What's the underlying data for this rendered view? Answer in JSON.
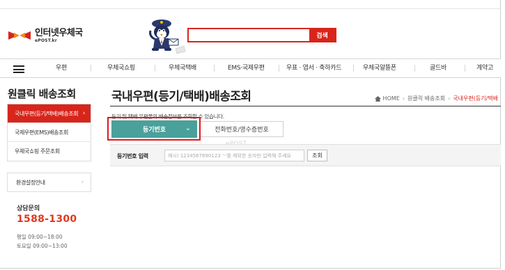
{
  "header": {
    "logo_ko": "인터넷우체국",
    "logo_en": "ePOST.kr",
    "search_placeholder": "",
    "search_button": "검색"
  },
  "gnb": {
    "items": [
      "우편",
      "우체국쇼핑",
      "우체국택배",
      "EMS·국제우편",
      "우표 · 엽서 · 축하카드",
      "우체국알뜰폰",
      "골드바",
      "계약고"
    ]
  },
  "sidebar": {
    "title": "원클릭 배송조회",
    "items": [
      {
        "label": "국내우편(등기/택배)배송조회",
        "active": true
      },
      {
        "label": "국제우편(EMS)배송조회",
        "active": false
      },
      {
        "label": "우체국쇼핑 주문조회",
        "active": false
      }
    ],
    "env_label": "환경설정안내",
    "contact_title": "상담문의",
    "contact_phone": "1588-1300",
    "hours_weekday": "평일 09:00~18:00",
    "hours_saturday": "토요일 09:00~13:00"
  },
  "main": {
    "page_title": "국내우편(등기/택배)배송조회",
    "breadcrumb": [
      "HOME",
      "원클릭 배송조회",
      "국내우편(등기/택배"
    ],
    "description": "등기 및 택배 우편물의 배송정보를 조회할 수 있습니다.",
    "tabs": [
      {
        "label": "등기번호",
        "selected": true
      },
      {
        "label": "전화번호/영수증번호",
        "selected": false
      }
    ],
    "watermark": "ePOST",
    "form_label": "등기번호 입력",
    "form_placeholder": "예시) 1234567890123 '-'를 제외한 숫자만 입력해 주세요",
    "form_button": "조회"
  },
  "colors": {
    "brand_red": "#d8251c",
    "tab_teal": "#4aa09a",
    "phone_orange": "#e03a1e"
  },
  "icons": [
    "epost-logo-icon",
    "mascot-illustration",
    "hamburger-menu-icon",
    "home-icon",
    "chevron-right-icon",
    "chevron-down-icon"
  ]
}
